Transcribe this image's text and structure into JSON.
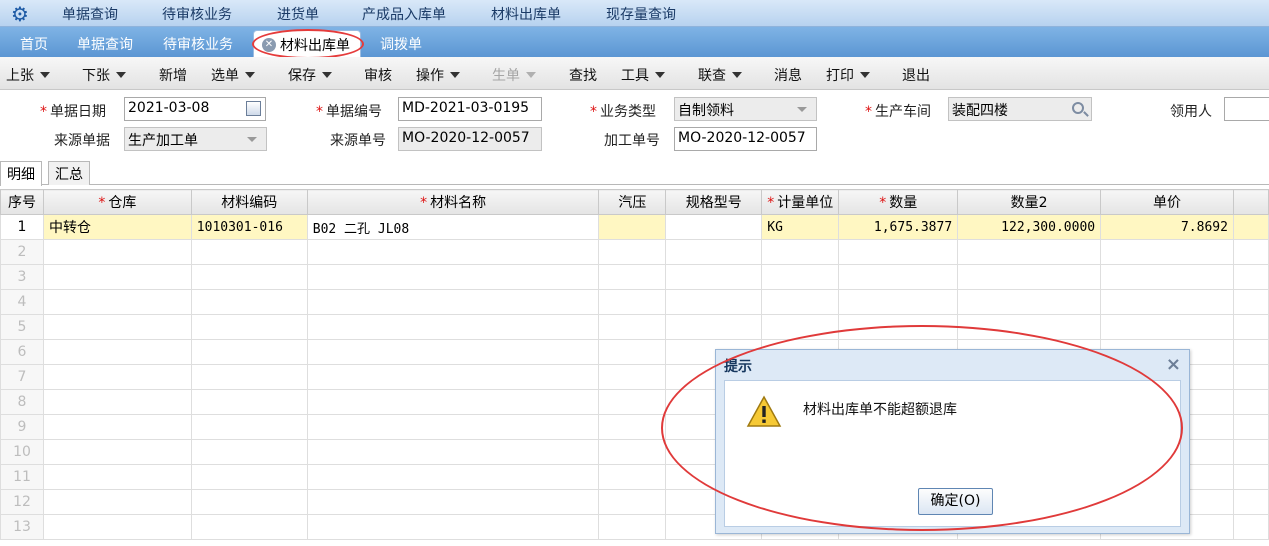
{
  "top_nav": {
    "items": [
      "单据查询",
      "待审核业务",
      "进货单",
      "产成品入库单",
      "材料出库单",
      "现存量查询"
    ]
  },
  "tabs": {
    "items": [
      "首页",
      "单据查询",
      "待审核业务",
      "材料出库单",
      "调拨单"
    ],
    "active": "材料出库单"
  },
  "toolbar": {
    "items": [
      "上张",
      "下张",
      "新增",
      "选单",
      "保存",
      "审核",
      "操作",
      "生单",
      "查找",
      "工具",
      "联查",
      "消息",
      "打印",
      "退出"
    ]
  },
  "form": {
    "doc_date_label": "单据日期",
    "doc_date_value": "2021-03-08",
    "doc_no_label": "单据编号",
    "doc_no_value": "MD-2021-03-0195",
    "biz_type_label": "业务类型",
    "biz_type_value": "自制领料",
    "workshop_label": "生产车间",
    "workshop_value": "装配四楼",
    "requester_label": "领用人",
    "requester_value": "",
    "source_doc_label": "来源单据",
    "source_doc_value": "生产加工单",
    "source_no_label": "来源单号",
    "source_no_value": "MO-2020-12-0057",
    "process_no_label": "加工单号",
    "process_no_value": "MO-2020-12-0057"
  },
  "subtabs": [
    "明细",
    "汇总"
  ],
  "grid": {
    "headers": [
      "序号",
      "仓库",
      "材料编码",
      "材料名称",
      "汽压",
      "规格型号",
      "计量单位",
      "数量",
      "数量2",
      "单价"
    ],
    "required_marker": "*",
    "rows": [
      {
        "no": "1",
        "warehouse": "中转仓",
        "code": "1010301-016",
        "name": "B02 二孔 JL08",
        "pressure": "",
        "spec": "",
        "unit": "KG",
        "qty": "1,675.3877",
        "qty2": "122,300.0000",
        "price": "7.8692"
      }
    ],
    "empty_row_numbers": [
      "2",
      "3",
      "4",
      "5",
      "6",
      "7",
      "8",
      "9",
      "10",
      "11",
      "12",
      "13"
    ]
  },
  "dialog": {
    "title": "提示",
    "close_glyph": "×",
    "message": "材料出库单不能超额退库",
    "ok_label": "确定(O)"
  }
}
